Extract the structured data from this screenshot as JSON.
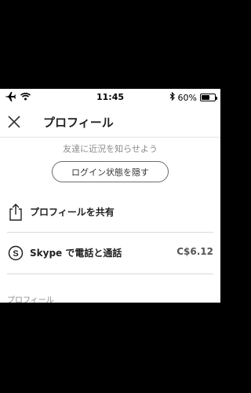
{
  "status_bar": {
    "time": "11:45",
    "battery_text": "60%",
    "battery_level": 0.6,
    "icons": [
      "airplane-icon",
      "wifi-icon",
      "bluetooth-icon",
      "battery-icon"
    ]
  },
  "header": {
    "title": "プロフィール",
    "close_icon": "close-icon"
  },
  "status_hint": "友達に近況を知らせよう",
  "hide_button": "ログイン状態を隠す",
  "rows": [
    {
      "label": "プロフィールを共有",
      "icon": "share-icon"
    },
    {
      "label": "Skype で電話と通話",
      "icon": "skype-icon",
      "value": "C$6.12"
    }
  ],
  "section_label": "プロフィール"
}
